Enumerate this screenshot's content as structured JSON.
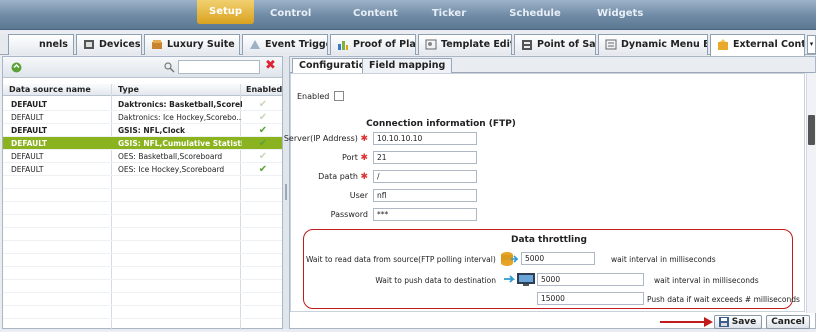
{
  "topnav": {
    "items": [
      "Setup",
      "Control",
      "Content",
      "Ticker",
      "Schedule",
      "Widgets"
    ]
  },
  "tabs": [
    {
      "label": "nnels",
      "icon": "channels-icon"
    },
    {
      "label": "Devices",
      "icon": "devices-icon"
    },
    {
      "label": "Luxury Suite",
      "icon": "suite-icon"
    },
    {
      "label": "Event Triggers",
      "icon": "trigger-icon"
    },
    {
      "label": "Proof of Play",
      "icon": "chart-icon"
    },
    {
      "label": "Template Editor",
      "icon": "template-icon"
    },
    {
      "label": "Point of Sale",
      "icon": "pos-icon"
    },
    {
      "label": "Dynamic Menu Boards",
      "icon": "menu-board-icon"
    },
    {
      "label": "External Content",
      "icon": "external-content-icon"
    }
  ],
  "grid": {
    "headers": [
      "Data source name",
      "Type",
      "Enabled"
    ],
    "rows": [
      {
        "name": "DEFAULT",
        "type": "Daktronics: Basketball,Scorebo...",
        "enabled": false,
        "bold": true
      },
      {
        "name": "DEFAULT",
        "type": "Daktronics: Ice Hockey,Scorebo...",
        "enabled": false,
        "bold": false
      },
      {
        "name": "DEFAULT",
        "type": "GSIS: NFL,Clock",
        "enabled": true,
        "bold": true
      },
      {
        "name": "DEFAULT",
        "type": "GSIS: NFL,Cumulative Statistics",
        "enabled": true,
        "bold": true,
        "selected": true
      },
      {
        "name": "DEFAULT",
        "type": "OES: Basketball,Scoreboard",
        "enabled": false,
        "bold": false
      },
      {
        "name": "DEFAULT",
        "type": "OES: Ice Hockey,Scoreboard",
        "enabled": true,
        "bold": false
      }
    ]
  },
  "right": {
    "tabs": [
      "Configuration",
      "Field mapping"
    ],
    "enabled_label": "Enabled",
    "conn_title": "Connection information (FTP)",
    "server_label": "Server(IP Address)",
    "server_value": "10.10.10.10",
    "port_label": "Port",
    "port_value": "21",
    "path_label": "Data path",
    "path_value": "/",
    "user_label": "User",
    "user_value": "nfl",
    "password_label": "Password",
    "password_value": "***",
    "thr_title": "Data throttling",
    "read_label": "Wait to read data from source(FTP polling interval)",
    "read_value": "5000",
    "read_unit": "wait interval in milliseconds",
    "push_label": "Wait to push data to destination",
    "push_value": "5000",
    "push_unit": "wait interval in milliseconds",
    "max_value": "15000",
    "max_unit": "Push data if wait exceeds # milliseconds",
    "save": "Save",
    "cancel": "Cancel"
  },
  "colors": {
    "accent": "#8bb21f",
    "setup": "#d9a21f",
    "highlight": "#c11b1b"
  }
}
